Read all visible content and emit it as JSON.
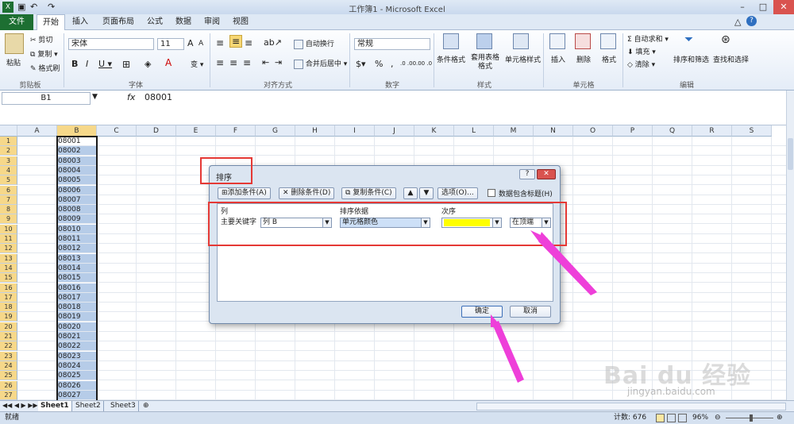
{
  "window": {
    "title": "工作簿1 - Microsoft Excel",
    "min": "–",
    "max": "□",
    "close": "✕"
  },
  "tabs": [
    "文件",
    "开始",
    "插入",
    "页面布局",
    "公式",
    "数据",
    "审阅",
    "视图"
  ],
  "ribbon": {
    "clipboard": {
      "label": "剪贴板",
      "paste": "粘贴",
      "cut": "剪切",
      "copy": "复制 ▾",
      "painter": "格式刷"
    },
    "font": {
      "label": "字体",
      "name": "宋体",
      "size": "11",
      "grow": "A",
      "shrink": "A",
      "bold": "B",
      "italic": "I",
      "underline": "U ▾",
      "wen": "变 ▾"
    },
    "align": {
      "label": "对齐方式",
      "wrap": "自动换行",
      "merge": "合并后居中 ▾"
    },
    "number": {
      "label": "数字",
      "format": "常规",
      "percent": "%",
      "comma": ",",
      "dec_inc": ".0 .00",
      "dec_dec": ".00 .0"
    },
    "styles": {
      "label": "样式",
      "cond": "条件格式",
      "table": "套用表格格式",
      "cell": "单元格样式"
    },
    "cells": {
      "label": "单元格",
      "insert": "插入",
      "delete": "删除",
      "format": "格式"
    },
    "edit": {
      "label": "编辑",
      "autosum": "Σ 自动求和 ▾",
      "fill": "填充 ▾",
      "clear": "清除 ▾",
      "sort": "排序和筛选",
      "find": "查找和选择"
    }
  },
  "formula": {
    "namebox": "B1",
    "fx": "fx",
    "value": "08001"
  },
  "columns": [
    "A",
    "B",
    "C",
    "D",
    "E",
    "F",
    "G",
    "H",
    "I",
    "J",
    "K",
    "L",
    "M",
    "N",
    "O",
    "P",
    "Q",
    "R",
    "S"
  ],
  "rows": [
    "1",
    "2",
    "3",
    "4",
    "5",
    "6",
    "7",
    "8",
    "9",
    "10",
    "11",
    "12",
    "13",
    "14",
    "15",
    "16",
    "17",
    "18",
    "19",
    "20",
    "21",
    "22",
    "23",
    "24",
    "25",
    "26",
    "27"
  ],
  "cells_b": [
    "08001",
    "08002",
    "08003",
    "08004",
    "08005",
    "08006",
    "08007",
    "08008",
    "08009",
    "08010",
    "08011",
    "08012",
    "08013",
    "08014",
    "08015",
    "08016",
    "08017",
    "08018",
    "08019",
    "08020",
    "08021",
    "08022",
    "08023",
    "08024",
    "08025",
    "08026",
    "08027"
  ],
  "sheets": [
    "Sheet1",
    "Sheet2",
    "Sheet3"
  ],
  "status": {
    "ready": "就绪",
    "count": "计数: 676",
    "zoom": "96%"
  },
  "dialog": {
    "title": "排序",
    "help": "?",
    "close": "✕",
    "add": "添加条件(A)",
    "delete": "删除条件(D)",
    "copy": "复制条件(C)",
    "options": "选项(O)...",
    "header_checkbox": "数据包含标题(H)",
    "col_header": "列",
    "sorton_header": "排序依据",
    "order_header": "次序",
    "row_label": "主要关键字",
    "col_value": "列 B",
    "sorton_value": "单元格颜色",
    "order_color": "#ffff00",
    "order_position": "在顶端",
    "ok": "确定",
    "cancel": "取消"
  },
  "watermark": {
    "brand": "Bai du 经验",
    "url": "jingyan.baidu.com"
  }
}
